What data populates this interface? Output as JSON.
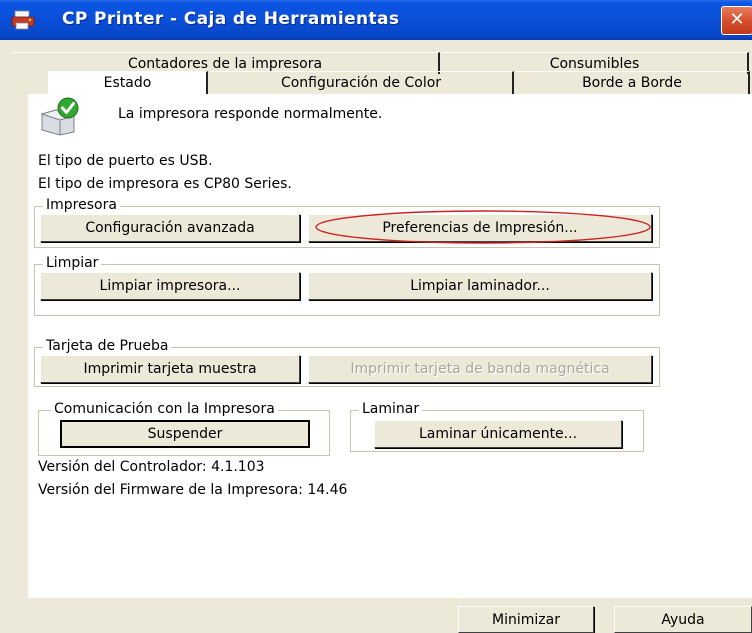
{
  "window": {
    "title": "CP Printer - Caja de Herramientas",
    "close_glyph": "✕"
  },
  "tabs": {
    "row1": [
      "Contadores de la impresora",
      "Consumibles"
    ],
    "row2": [
      "Estado",
      "Configuración de Color",
      "Borde a Borde"
    ],
    "active": "Estado"
  },
  "status": {
    "icon": "printer-ok-icon",
    "message": "La impresora responde normalmente."
  },
  "info": {
    "port": "El tipo de puerto es USB.",
    "printer_type": "El tipo de impresora es CP80 Series."
  },
  "groups": {
    "impresora": {
      "title": "Impresora",
      "advanced_button": "Configuración avanzada",
      "preferences_button": "Preferencias de Impresión..."
    },
    "limpiar": {
      "title": "Limpiar",
      "clean_printer_button": "Limpiar impresora...",
      "clean_laminator_button": "Limpiar laminador..."
    },
    "tarjeta": {
      "title": "Tarjeta de Prueba",
      "print_sample_button": "Imprimir tarjeta muestra",
      "print_magnetic_button": "Imprimir tarjeta de banda magnética"
    },
    "comunicacion": {
      "title": "Comunicación con la Impresora",
      "suspend_button": "Suspender"
    },
    "laminar": {
      "title": "Laminar",
      "laminate_button": "Laminar únicamente..."
    }
  },
  "versions": {
    "driver": "Versión del Controlador:  4.1.103",
    "firmware": "Versión del Firmware de la Impresora: 14.46"
  },
  "footer": {
    "minimize_button": "Minimizar",
    "help_button": "Ayuda"
  },
  "colors": {
    "titlebar": "#0a4fd8",
    "dialog_bg": "#ece9d8",
    "highlight": "#cc2222",
    "status_ok": "#2fa82f"
  }
}
